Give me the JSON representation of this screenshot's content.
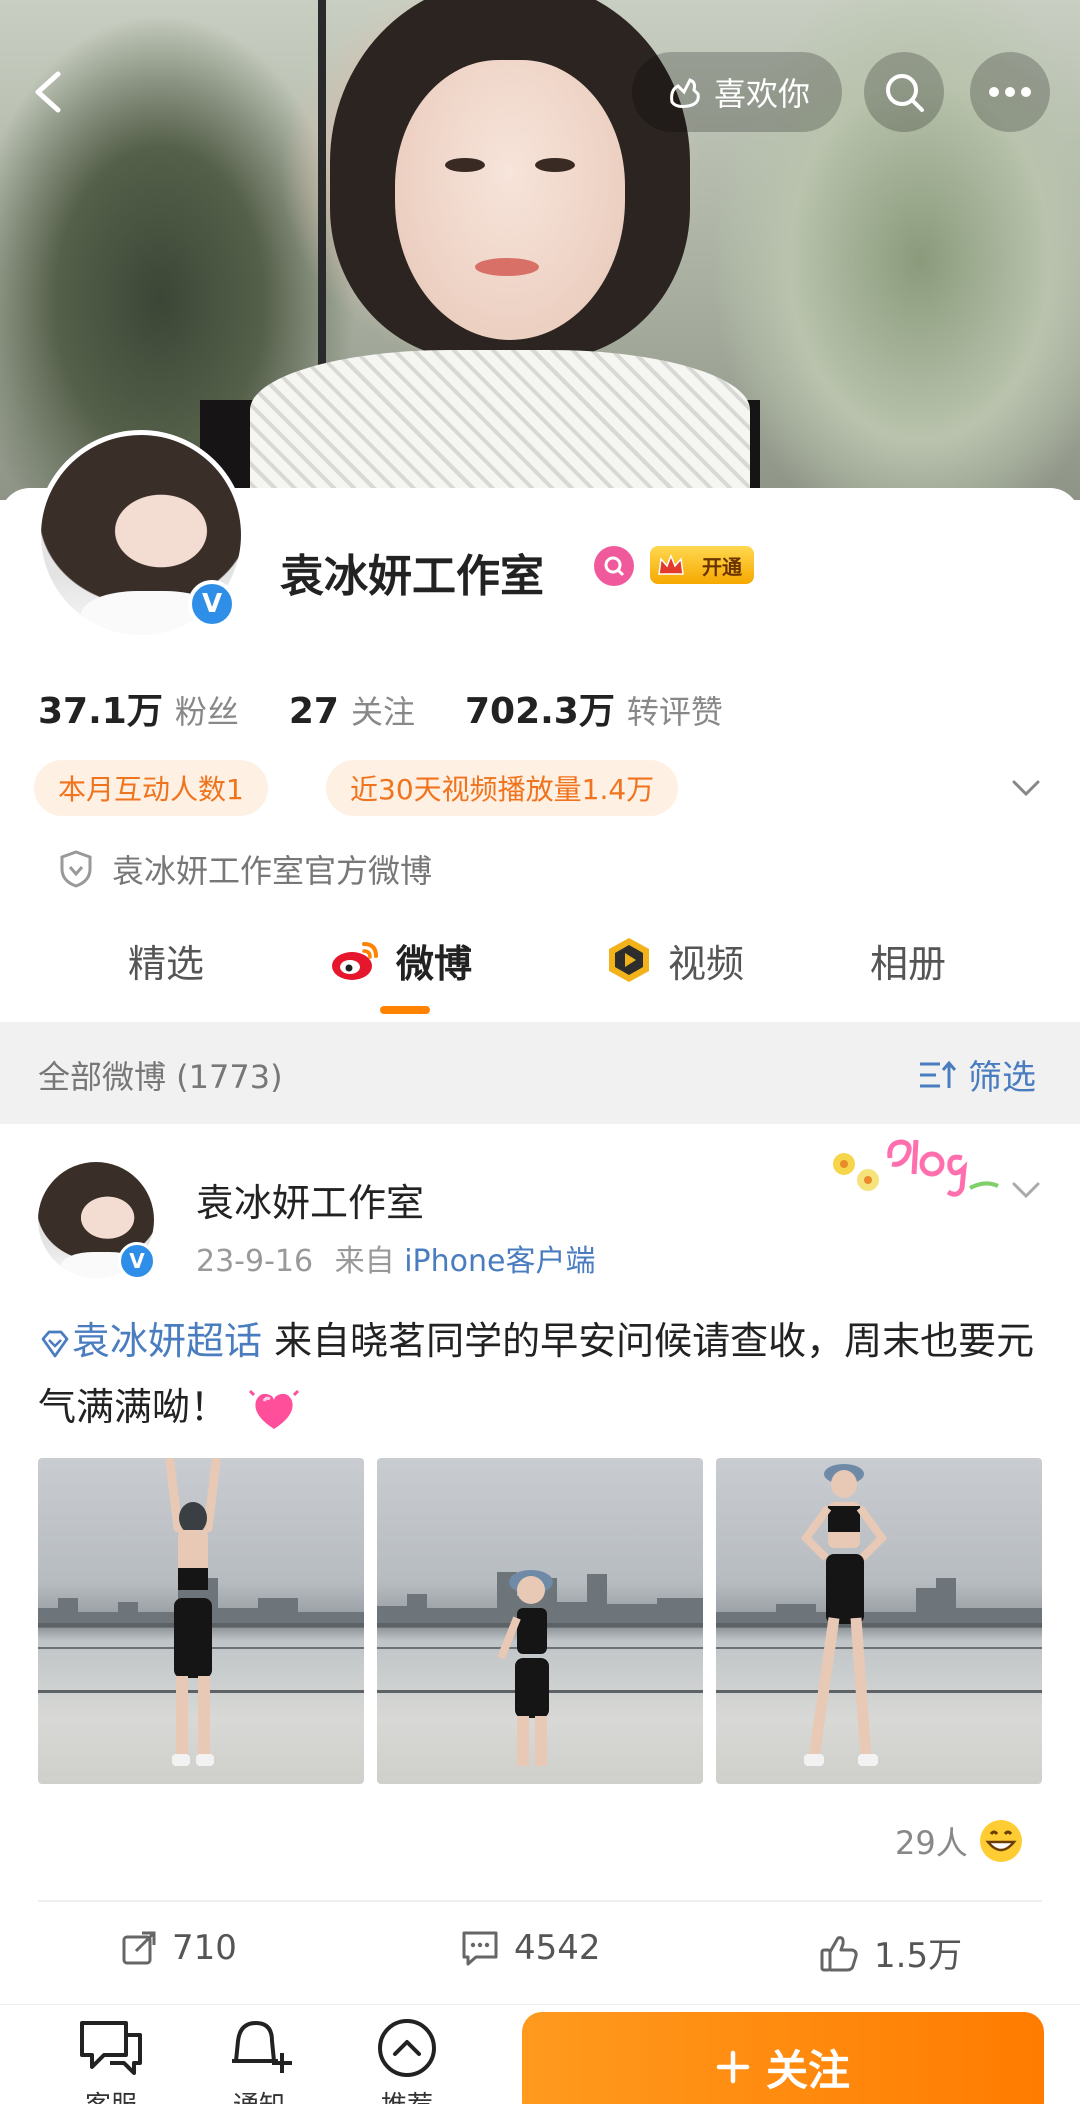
{
  "header": {
    "like_label": "喜欢你"
  },
  "profile": {
    "name": "袁冰妍工作室",
    "vip_label": "开通",
    "stats": [
      {
        "value": "37.1万",
        "label": "粉丝"
      },
      {
        "value": "27",
        "label": "关注"
      },
      {
        "value": "702.3万",
        "label": "转评赞"
      }
    ],
    "tags": [
      "本月互动人数1",
      "近30天视频播放量1.4万"
    ],
    "official_desc": "袁冰妍工作室官方微博"
  },
  "tabs": {
    "items": [
      "精选",
      "微博",
      "视频",
      "相册"
    ],
    "active": "微博"
  },
  "feed": {
    "count_label": "全部微博 (1773)",
    "filter_label": "筛选"
  },
  "post": {
    "author": "袁冰妍工作室",
    "date": "23-9-16",
    "from_prefix": "来自",
    "source": "iPhone客户端",
    "topic": "袁冰妍超话",
    "text": " 来自晓茗同学的早安问候请查收，周末也要元气满满呦！",
    "likers_label": "29人",
    "repost_count": "710",
    "comment_count": "4542",
    "like_count": "1.5万"
  },
  "bottom_nav": {
    "items": [
      "客服",
      "通知",
      "推荐"
    ],
    "follow_label": "关注"
  },
  "colors": {
    "accent_orange": "#ff8200",
    "link_blue": "#4a7cc0",
    "verified_blue": "#2f8fe8",
    "tag_bg": "#fff0e4",
    "tag_text": "#f0741e"
  }
}
